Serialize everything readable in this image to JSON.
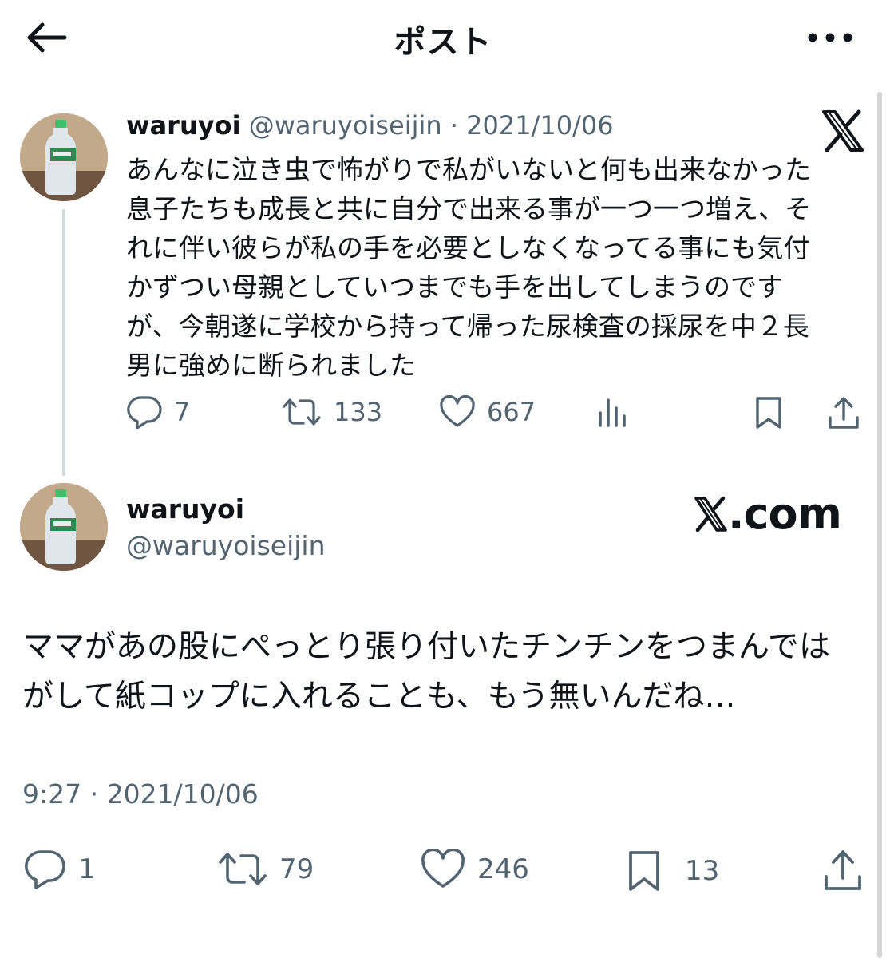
{
  "header": {
    "title": "ポスト"
  },
  "quoted_post": {
    "display_name": "waruyoi",
    "handle": "@waruyoiseijin",
    "separator": "·",
    "date": "2021/10/06",
    "text": "あんなに泣き虫で怖がりで私がいないと何も出来なかった\n息子たちも成長と共に自分で出来る事が一つ一つ増え、そ\nれに伴い彼らが私の手を必要としなくなってる事にも気付\nかずつい母親としていつまでも手を出してしまうのです\nが、今朝遂に学校から持って帰った尿検査の採尿を中２長\n男に強めに断られました",
    "actions": {
      "replies": "7",
      "reposts": "133",
      "likes": "667"
    }
  },
  "post": {
    "display_name": "waruyoi",
    "handle": "@waruyoiseijin",
    "brand_text": ".com",
    "text": "ママがあの股にぺっとり張り付いたチンチンをつまんでは\nがして紙コップに入れることも、もう無いんだね…",
    "timestamp": "9:27 · 2021/10/06",
    "actions": {
      "replies": "1",
      "reposts": "79",
      "likes": "246",
      "bookmarks": "13"
    }
  },
  "icons": {
    "back": "back-arrow-icon",
    "more": "more-icon",
    "reply": "reply-icon",
    "repost": "repost-icon",
    "like": "heart-icon",
    "views": "views-icon",
    "bookmark": "bookmark-icon",
    "share": "share-icon"
  },
  "colors": {
    "text": "#0f1419",
    "secondary": "#536471",
    "thread_line": "#cfd9de"
  }
}
